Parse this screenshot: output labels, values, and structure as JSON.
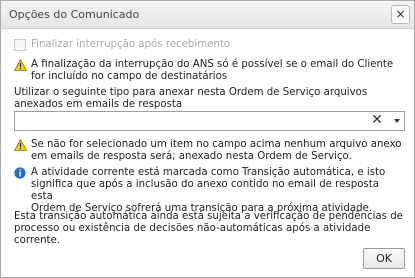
{
  "dialog": {
    "title": "Opções do Comunicado",
    "close_glyph": "×",
    "checkbox_label": "Finalizar interrupção após recebimento",
    "warning1_line1": "A finalização da interrupção do ANS só é possível se o email do Cliente",
    "warning1_line2": "for incluído no campo de destinatários",
    "field_label_line1": "Utilizar o seguinte tipo para anexar nesta Ordem de Serviço arquivos",
    "field_label_line2": "anexados em emails de resposta",
    "field_value": "",
    "clear_glyph": "✕",
    "warning2_line1": "Se não for selecionado um item no campo acima nenhum arquivo anexo",
    "warning2_line2": "em emails de resposta será; anexado nesta Ordem de Serviço.",
    "info_line1": "A atividade corrente está marcada como Transição automática, e isto",
    "info_line2": "significa que após a inclusão do anexo contido no email de resposta esta",
    "info_line3": "Ordem de Serviço sofrerá uma transição para a próxima atividade.",
    "note_line1": "Esta transição automática ainda está sujeita a verificação de pendências de",
    "note_line2": "processo ou existência de decisões não-automáticas após a atividade",
    "note_line3": "corrente.",
    "ok_label": "OK"
  },
  "icons": {
    "warning": "warning-triangle-icon",
    "info": "info-circle-icon",
    "clear": "clear-icon",
    "dropdown": "chevron-down-icon"
  },
  "colors": {
    "warning_fill": "#f6d21a",
    "info_fill": "#1f6fc5"
  }
}
